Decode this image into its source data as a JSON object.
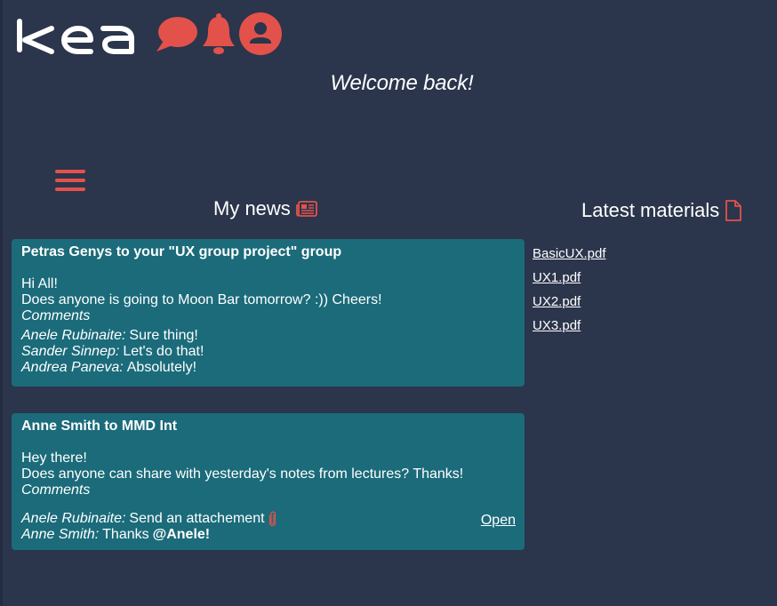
{
  "brand": {
    "logo_text": "kea",
    "accent_color": "#e2524a",
    "background": "#2b354c",
    "card_color": "#1b6b7a"
  },
  "header": {
    "icons": [
      "chat-icon",
      "bell-icon",
      "profile-icon"
    ]
  },
  "welcome": "Welcome back!",
  "news": {
    "title": "My news",
    "icon": "newspaper-icon",
    "posts": [
      {
        "header": "Petras Genys to your \"UX group project\" group",
        "greeting": "Hi All!",
        "body": "Does anyone is going to Moon Bar tomorrow? :)) Cheers!",
        "comments_label": "Comments",
        "comments": [
          {
            "author": "Anele Rubinaite:",
            "text": "Sure thing!"
          },
          {
            "author": "Sander Sinnep:",
            "text": "Let's do that!"
          },
          {
            "author": "Andrea Paneva:",
            "text": "Absolutely!"
          }
        ]
      },
      {
        "header": "Anne Smith to MMD Int",
        "greeting": "Hey there!",
        "body": "Does anyone can share with yesterday's notes from lectures? Thanks!",
        "comments_label": "Comments",
        "comments": [
          {
            "author": "Anele Rubinaite:",
            "text": "Send an attachement",
            "attachment_icon": "paperclip-icon",
            "action": "Open"
          },
          {
            "author": "Anne Smith:",
            "text": "Thanks",
            "mention": "@Anele!"
          }
        ]
      }
    ]
  },
  "materials": {
    "title": "Latest materials",
    "icon": "document-icon",
    "files": [
      "BasicUX.pdf",
      "UX1.pdf",
      "UX2.pdf",
      "UX3.pdf"
    ]
  }
}
